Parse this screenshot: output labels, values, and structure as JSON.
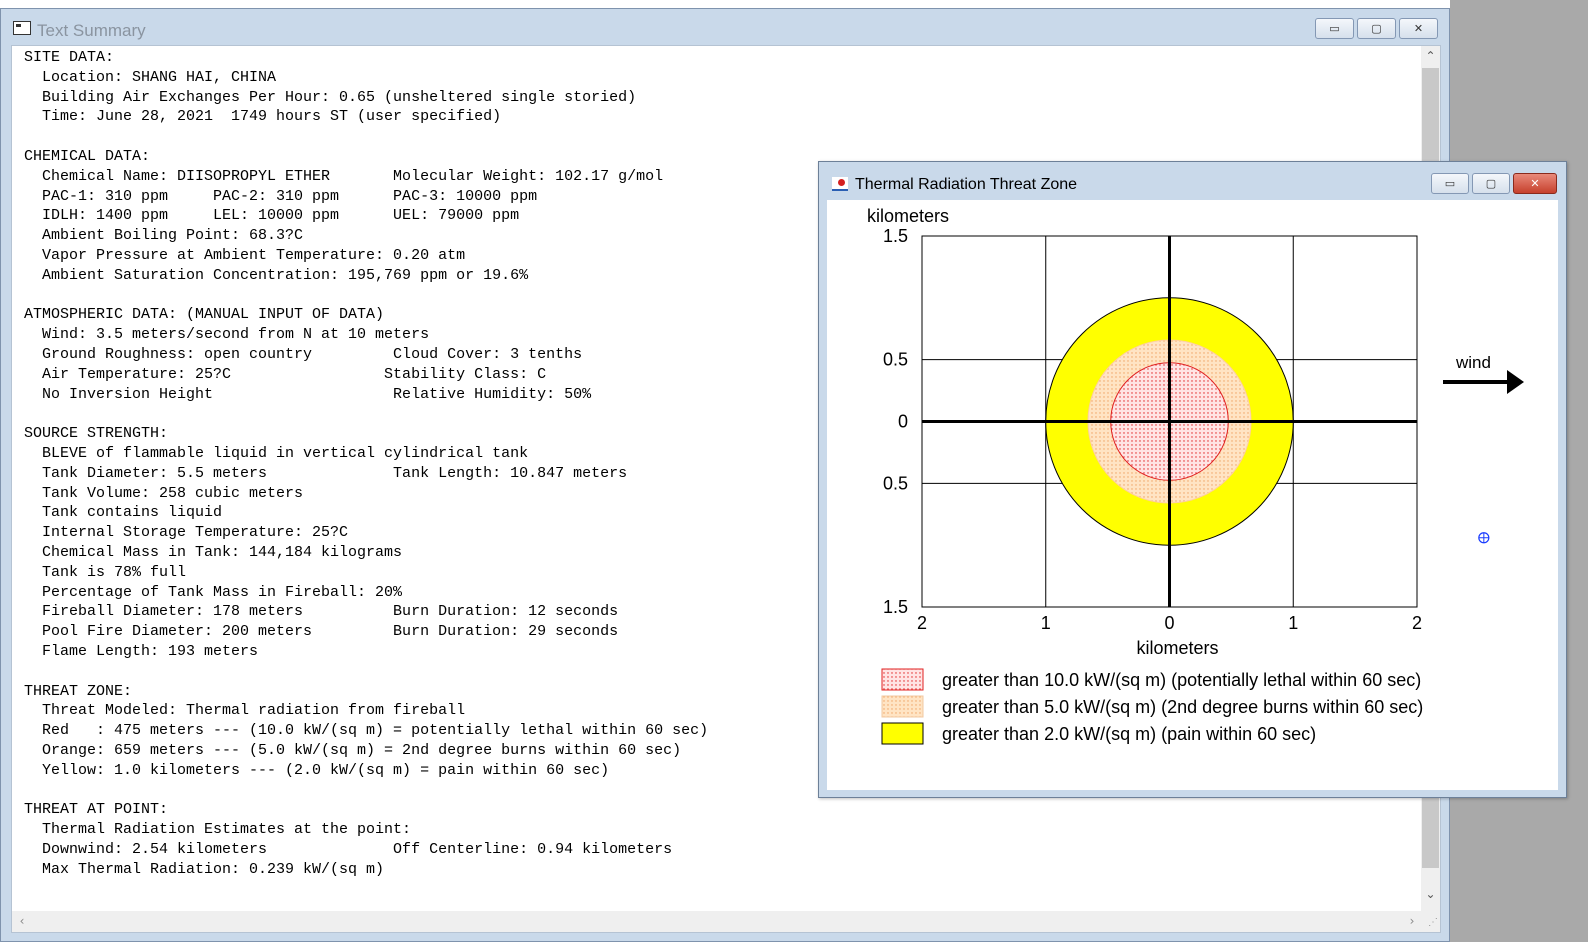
{
  "text_window": {
    "title": "Text Summary",
    "buttons": {
      "minimize": "▭",
      "maximize": "▢",
      "close": "✕"
    },
    "report_lines": [
      "SITE DATA:",
      "  Location: SHANG HAI, CHINA",
      "  Building Air Exchanges Per Hour: 0.65 (unsheltered single storied)",
      "  Time: June 28, 2021  1749 hours ST (user specified)",
      "",
      "CHEMICAL DATA:",
      "  Chemical Name: DIISOPROPYL ETHER       Molecular Weight: 102.17 g/mol",
      "  PAC-1: 310 ppm     PAC-2: 310 ppm      PAC-3: 10000 ppm",
      "  IDLH: 1400 ppm     LEL: 10000 ppm      UEL: 79000 ppm",
      "  Ambient Boiling Point: 68.3?C",
      "  Vapor Pressure at Ambient Temperature: 0.20 atm",
      "  Ambient Saturation Concentration: 195,769 ppm or 19.6%",
      "",
      "ATMOSPHERIC DATA: (MANUAL INPUT OF DATA)",
      "  Wind: 3.5 meters/second from N at 10 meters",
      "  Ground Roughness: open country         Cloud Cover: 3 tenths",
      "  Air Temperature: 25?C                 Stability Class: C",
      "  No Inversion Height                    Relative Humidity: 50%",
      "",
      "SOURCE STRENGTH:",
      "  BLEVE of flammable liquid in vertical cylindrical tank",
      "  Tank Diameter: 5.5 meters              Tank Length: 10.847 meters",
      "  Tank Volume: 258 cubic meters",
      "  Tank contains liquid",
      "  Internal Storage Temperature: 25?C",
      "  Chemical Mass in Tank: 144,184 kilograms",
      "  Tank is 78% full",
      "  Percentage of Tank Mass in Fireball: 20%",
      "  Fireball Diameter: 178 meters          Burn Duration: 12 seconds",
      "  Pool Fire Diameter: 200 meters         Burn Duration: 29 seconds",
      "  Flame Length: 193 meters",
      "",
      "THREAT ZONE:",
      "  Threat Modeled: Thermal radiation from fireball",
      "  Red   : 475 meters --- (10.0 kW/(sq m) = potentially lethal within 60 sec)",
      "  Orange: 659 meters --- (5.0 kW/(sq m) = 2nd degree burns within 60 sec)",
      "  Yellow: 1.0 kilometers --- (2.0 kW/(sq m) = pain within 60 sec)",
      "",
      "THREAT AT POINT:",
      "  Thermal Radiation Estimates at the point:",
      "  Downwind: 2.54 kilometers              Off Centerline: 0.94 kilometers",
      "  Max Thermal Radiation: 0.239 kW/(sq m)"
    ]
  },
  "chart_window": {
    "title": "Thermal Radiation Threat Zone",
    "buttons": {
      "minimize": "▭",
      "maximize": "▢",
      "close": "✕"
    }
  },
  "chart_data": {
    "type": "threat-zone",
    "ylabel": "kilometers",
    "xlabel": "kilometers",
    "xlim": [
      -2,
      2
    ],
    "ylim": [
      -1.5,
      1.5
    ],
    "x_tick_labels": [
      "2",
      "1",
      "0",
      "1",
      "2"
    ],
    "y_tick_labels": [
      "1.5",
      "0.5",
      "0",
      "0.5",
      "1.5"
    ],
    "grid": true,
    "wind_label": "wind",
    "zones": [
      {
        "name": "Red",
        "radius_km": 0.475,
        "fill": "#ffd6d6",
        "stroke": "#e02020",
        "pattern": "dots-red"
      },
      {
        "name": "Orange",
        "radius_km": 0.659,
        "fill": "#ffd8a6",
        "stroke": "#ffcfa0",
        "pattern": "dots-orange"
      },
      {
        "name": "Yellow",
        "radius_km": 1.0,
        "fill": "#ffff00",
        "stroke": "#000000",
        "pattern": "solid"
      }
    ],
    "point": {
      "x_km": 2.54,
      "y_km": -0.94,
      "color": "#1a3cff"
    },
    "legend": [
      {
        "label": "greater than 10.0 kW/(sq m) (potentially lethal within 60 sec)",
        "swatch": "red"
      },
      {
        "label": "greater than 5.0 kW/(sq m) (2nd degree burns within 60 sec)",
        "swatch": "orange"
      },
      {
        "label": "greater than 2.0 kW/(sq m) (pain within 60 sec)",
        "swatch": "yellow"
      }
    ]
  }
}
